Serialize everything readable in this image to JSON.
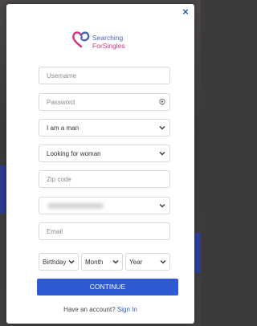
{
  "brand": {
    "line1": "Searching",
    "line2": "ForSingles",
    "colors": {
      "blue": "#4d63b5",
      "pink": "#d4357a"
    }
  },
  "close_label": "×",
  "form": {
    "username_placeholder": "Username",
    "password_placeholder": "Password",
    "gender_value": "I am a man",
    "seeking_value": "Looking for woman",
    "zip_placeholder": "Zip code",
    "email_placeholder": "Email",
    "birthday": {
      "day": "Birthday",
      "month": "Month",
      "year": "Year"
    }
  },
  "continue_label": "CONTINUE",
  "signin": {
    "prompt": "Have an account?",
    "link": "Sign In"
  },
  "icons": {
    "close": "close-icon",
    "eye": "eye-icon",
    "chevron": "chevron-down-icon",
    "logo": "heart-logo-icon"
  },
  "accent": "#2d5ad1"
}
